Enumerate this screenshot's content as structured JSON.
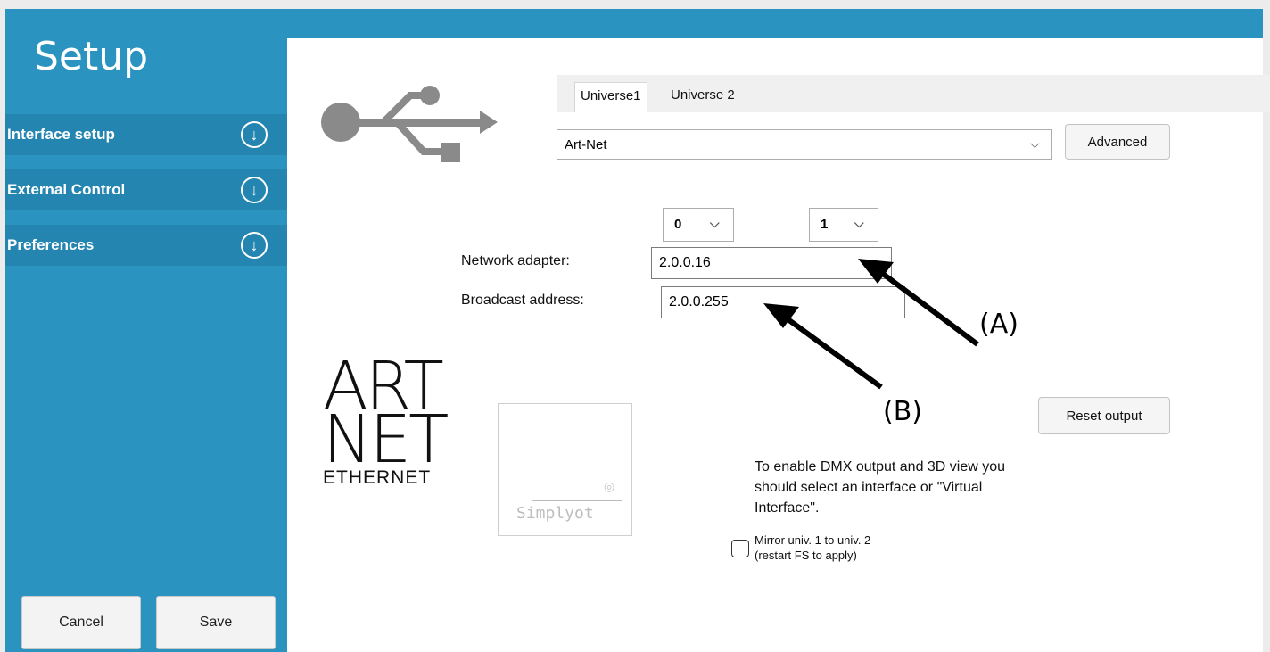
{
  "sidebar": {
    "title": "Setup",
    "items": [
      {
        "label": "Interface setup"
      },
      {
        "label": "External Control"
      },
      {
        "label": "Preferences"
      }
    ],
    "expand_glyph": "↓",
    "cancel_label": "Cancel",
    "save_label": "Save"
  },
  "tabs": [
    "Universe1",
    "Universe 2"
  ],
  "interface_select": {
    "value": "Art-Net"
  },
  "advanced_label": "Advanced",
  "net_select": {
    "value": "0"
  },
  "subnet_select": {
    "value": "1"
  },
  "network_adapter": {
    "label": "Network adapter:",
    "value": "2.0.0.16"
  },
  "broadcast_address": {
    "label": "Broadcast address:",
    "value": "2.0.0.255"
  },
  "logo": {
    "line1": "ART",
    "line2": "NET",
    "line3": "ETHERNET"
  },
  "watermark_text": "Simplyot",
  "reset_output_label": "Reset output",
  "info_text": "To enable DMX output and 3D view you should select an interface or \"Virtual Interface\".",
  "mirror_checkbox": {
    "line1": "Mirror univ. 1 to univ. 2",
    "line2": "(restart FS to apply)",
    "checked": false
  },
  "annotations": {
    "a": "(A)",
    "b": "(B)"
  },
  "colors": {
    "accent": "#2a93bf",
    "accent_dark": "#2385b0"
  },
  "icons": {
    "usb": "usb-icon",
    "dropdown": "chevron-down-icon",
    "expand": "arrow-down-circle-icon"
  }
}
